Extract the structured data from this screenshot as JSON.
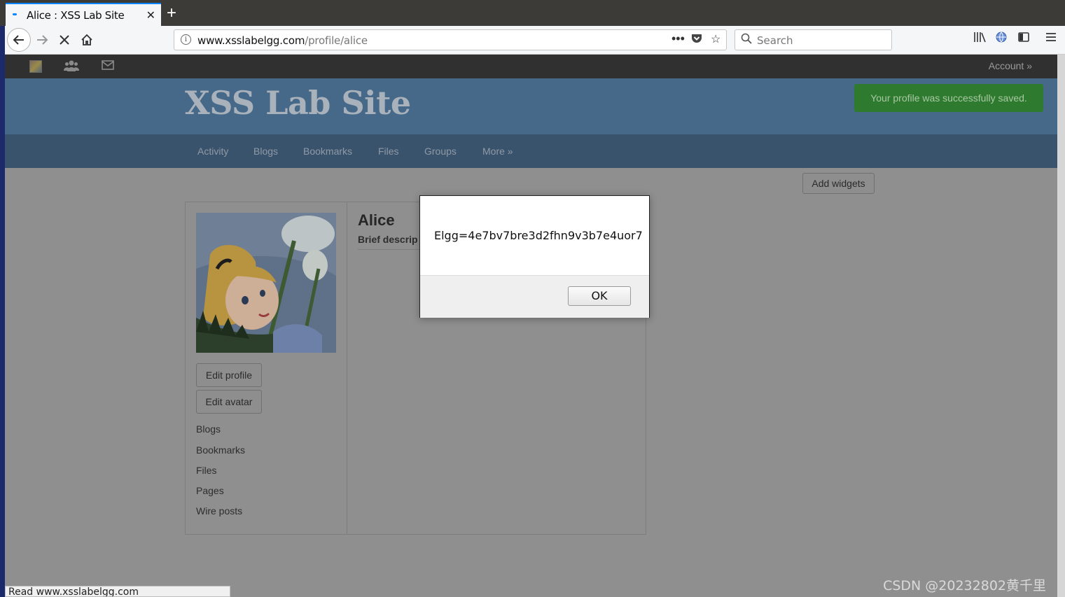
{
  "browser": {
    "tab_title": "Alice : XSS Lab Site",
    "tab_close": "✕",
    "new_tab": "+",
    "url_host": "www.xsslabelgg.com",
    "url_path": "/profile/alice",
    "search_placeholder": "Search"
  },
  "topbar": {
    "account_label": "Account »"
  },
  "header": {
    "site_name": "XSS Lab Site",
    "success_message": "Your profile was successfully saved."
  },
  "nav": {
    "items": [
      "Activity",
      "Blogs",
      "Bookmarks",
      "Files",
      "Groups",
      "More »"
    ]
  },
  "widgets": {
    "add_label": "Add widgets"
  },
  "profile": {
    "name": "Alice",
    "brief": "Brief descrip",
    "edit_profile": "Edit profile",
    "edit_avatar": "Edit avatar",
    "links": [
      "Blogs",
      "Bookmarks",
      "Files",
      "Pages",
      "Wire posts"
    ]
  },
  "alert": {
    "message": "Elgg=4e7bv7bre3d2fhn9v3b7e4uor7",
    "ok_label": "OK"
  },
  "status_bar": "Read www.xsslabelgg.com",
  "watermark": "CSDN @20232802黄千里"
}
